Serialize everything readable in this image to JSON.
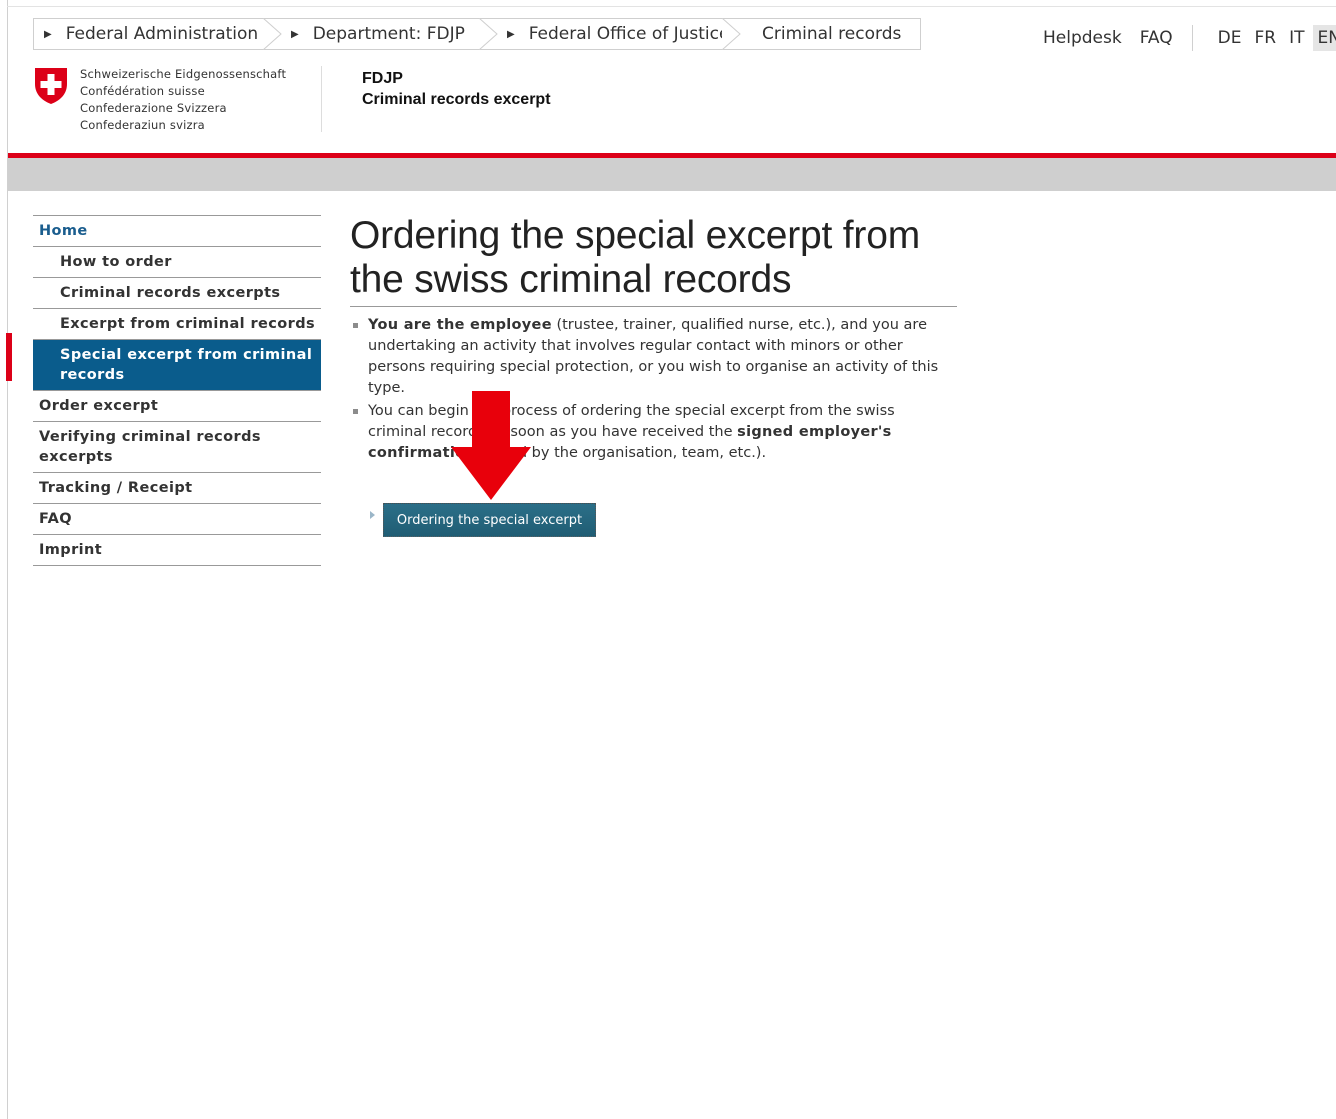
{
  "breadcrumb": {
    "items": [
      "Federal Administration",
      "Department: FDJP",
      "Federal Office of Justice",
      "Criminal records"
    ]
  },
  "top_links": {
    "helpdesk": "Helpdesk",
    "faq": "FAQ",
    "languages": [
      "DE",
      "FR",
      "IT",
      "EN"
    ],
    "active_language": "EN"
  },
  "logo": {
    "lines": [
      "Schweizerische Eidgenossenschaft",
      "Confédération suisse",
      "Confederazione Svizzera",
      "Confederaziun svizra"
    ]
  },
  "department": {
    "abbr": "FDJP",
    "name": "Criminal records excerpt"
  },
  "sidebar": {
    "items": [
      {
        "label": "Home"
      },
      {
        "label": "How to order"
      },
      {
        "label": "Criminal records excerpts"
      },
      {
        "label": "Excerpt from criminal records"
      },
      {
        "label": "Special excerpt from criminal records"
      },
      {
        "label": "Order excerpt"
      },
      {
        "label": "Verifying criminal records excerpts"
      },
      {
        "label": "Tracking / Receipt"
      },
      {
        "label": "FAQ"
      },
      {
        "label": "Imprint"
      }
    ]
  },
  "main": {
    "title": "Ordering the special excerpt from the swiss criminal records",
    "bullet1": {
      "bold": "You are the employee",
      "text": " (trustee, trainer, qualified nurse, etc.), and you are undertaking an activity that involves regular contact with minors or other persons requiring special protection, or you wish to organise an activity of this type."
    },
    "bullet2": {
      "text_before": "You can begin the process of ordering the special excerpt from the swiss criminal records as soon as you have received the ",
      "bold": "signed employer's confirmation",
      "text_after": " issued by the organisation, team, etc.)."
    },
    "button_label": "Ordering the special excerpt"
  },
  "colors": {
    "swiss_red": "#dc0018",
    "nav_active": "#0a5c8c",
    "button": "#256679",
    "annotation_arrow": "#e8000b"
  }
}
